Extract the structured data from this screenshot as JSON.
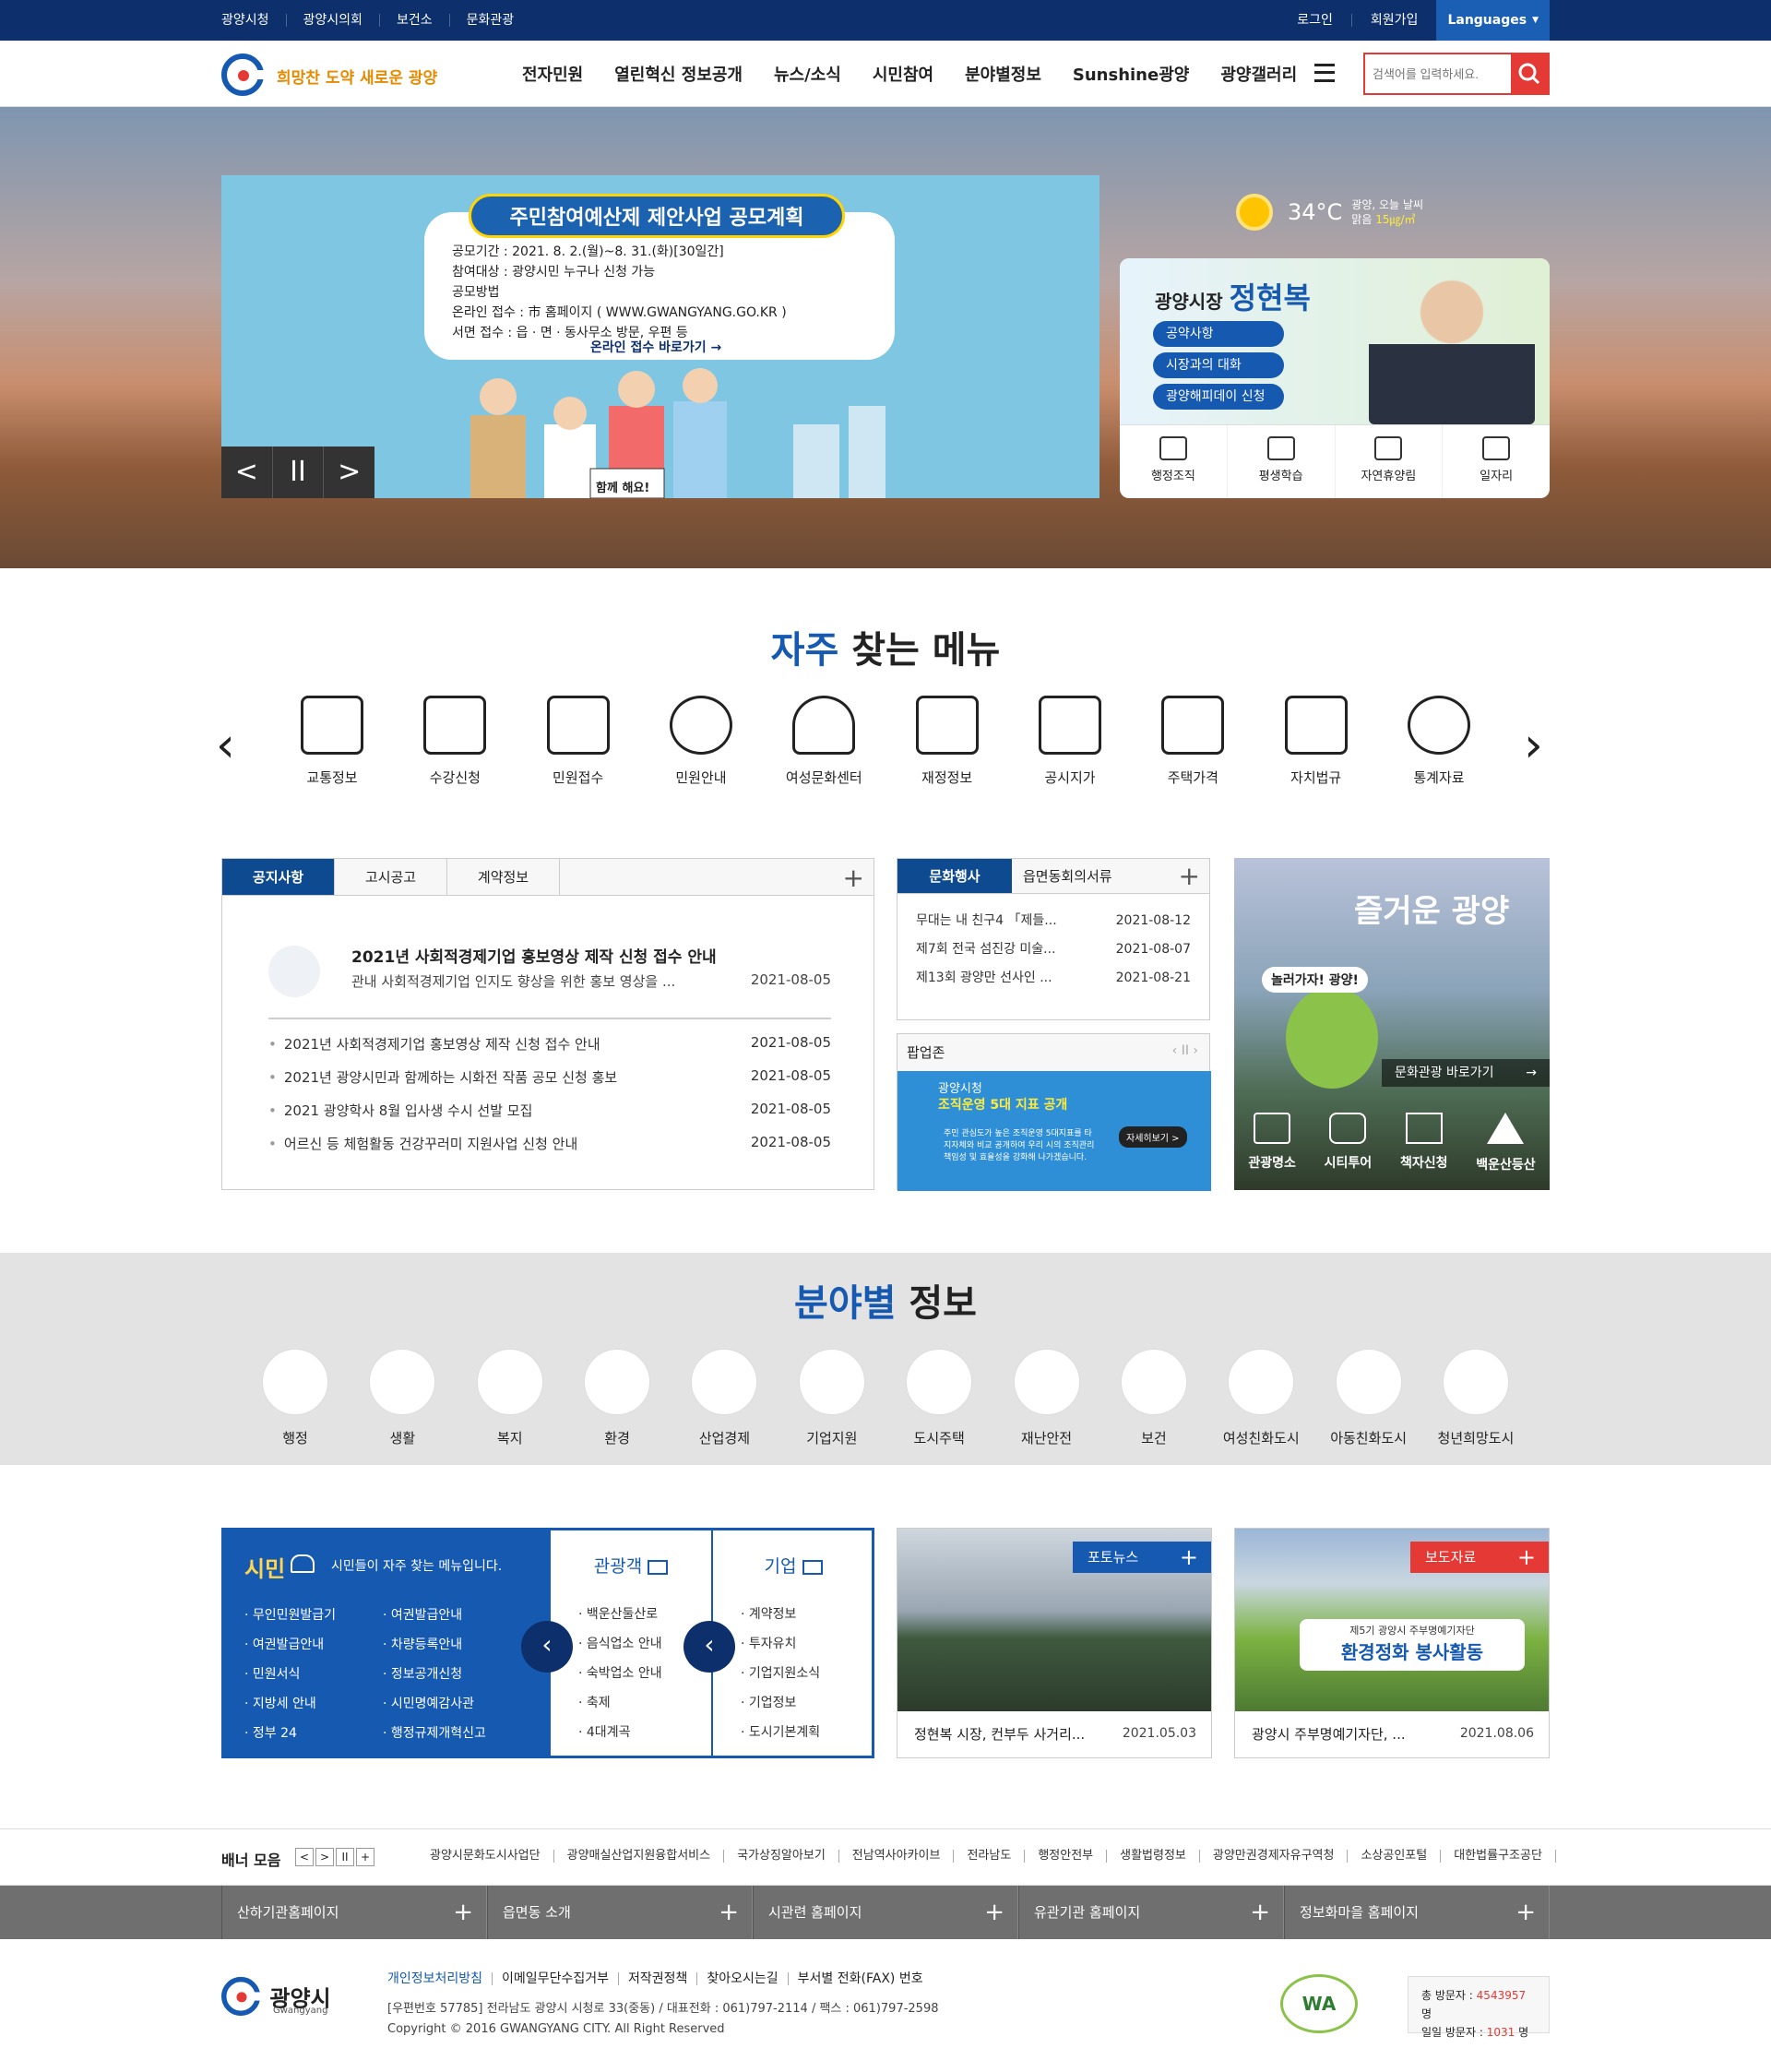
{
  "util": {
    "left": [
      "광양시청",
      "광양시의회",
      "보건소",
      "문화관광"
    ],
    "right": [
      "로그인",
      "회원가입"
    ],
    "language": "Languages"
  },
  "logo": {
    "slogan": "희망찬 도약 새로운 광양"
  },
  "gnb": [
    "전자민원",
    "열린혁신 정보공개",
    "뉴스/소식",
    "시민참여",
    "분야별정보",
    "Sunshine광양",
    "광양갤러리"
  ],
  "search": {
    "placeholder": "검색어를 입력하세요."
  },
  "hero_banner": {
    "title": "주민참여예산제 제안사업 공모계획",
    "lines": [
      "공모기간 : 2021. 8. 2.(월)~8. 31.(화)[30일간]",
      "참여대상 : 광양시민 누구나 신청 가능",
      "공모방법",
      "온라인 접수 : 市 홈페이지 ( WWW.GWANGYANG.GO.KR )",
      "서면 접수 : 읍 · 면 · 동사무소 방문, 우편 등"
    ],
    "link": "온라인 접수 바로가기 →",
    "sign": "함께 해요!",
    "controls": [
      "<",
      "II",
      ">"
    ]
  },
  "weather": {
    "temp": "34°C",
    "line1": "광양, 오늘 날씨",
    "line2": "맑음",
    "dust": "15㎍/㎥"
  },
  "mayor": {
    "prefix": "광양시장",
    "name": "정현복",
    "buttons": [
      "공약사항",
      "시장과의 대화",
      "광양해피데이 신청"
    ],
    "icons": [
      "행정조직",
      "평생학습",
      "자연휴양림",
      "일자리"
    ]
  },
  "quick": {
    "title_accent": "자주",
    "title_rest": " 찾는 메뉴",
    "items": [
      "교통정보",
      "수강신청",
      "민원접수",
      "민원안내",
      "여성문화센터",
      "재정정보",
      "공시지가",
      "주택가격",
      "자치법규",
      "통계자료"
    ]
  },
  "notice": {
    "tabs": [
      "공지사항",
      "고시공고",
      "계약정보"
    ],
    "featured": {
      "title": "2021년 사회적경제기업 홍보영상 제작 신청 접수 안내",
      "summary": "관내 사회적경제기업 인지도 향상을 위한 홍보 영상을 ...",
      "date": "2021-08-05"
    },
    "items": [
      {
        "title": "2021년 사회적경제기업 홍보영상 제작 신청 접수 안내",
        "date": "2021-08-05"
      },
      {
        "title": "2021년 광양시민과 함께하는 시화전 작품 공모 신청 홍보",
        "date": "2021-08-05"
      },
      {
        "title": "2021 광양학사 8월 입사생 수시 선발 모집",
        "date": "2021-08-05"
      },
      {
        "title": "어르신 등 체험활동 건강꾸러미 지원사업 신청 안내",
        "date": "2021-08-05"
      }
    ]
  },
  "culture": {
    "tabs": [
      "문화행사",
      "읍면동회의서류"
    ],
    "items": [
      {
        "title": "무대는 내 친구4 「제들...",
        "date": "2021-08-12"
      },
      {
        "title": "제7회 전국 섬진강 미술...",
        "date": "2021-08-07"
      },
      {
        "title": "제13회 광양만 선사인 ...",
        "date": "2021-08-21"
      }
    ]
  },
  "popup": {
    "label": "팝업존",
    "line1": "광양시청",
    "line2": "조직운영 5대 지표 공개",
    "desc": "주민 관심도가 높은 조직운영 5대지표를 타 지자체와 비교 공개하여 우리 시의 조직관리 책임성 및 효율성을 강화해 나가겠습니다.",
    "more": "자세히보기 >"
  },
  "tour": {
    "title": "즐거운 광양",
    "sign": "놀러가자! 광양!",
    "link": "문화관광 바로가기",
    "items": [
      "관광명소",
      "시티투어",
      "책자신청",
      "백운산등산"
    ]
  },
  "field": {
    "title_accent": "분야별",
    "title_rest": " 정보",
    "items": [
      "행정",
      "생활",
      "복지",
      "환경",
      "산업경제",
      "기업지원",
      "도시주택",
      "재난안전",
      "보건",
      "여성친화도시",
      "아동친화도시",
      "청년희망도시"
    ]
  },
  "citizen": {
    "title": "시민",
    "desc": "시민들이 자주 찾는 메뉴입니다.",
    "col1": [
      "· 무인민원발급기",
      "· 여권발급안내",
      "· 민원서식",
      "· 지방세 안내",
      "· 정부 24"
    ],
    "col2": [
      "· 여권발급안내",
      "· 차량등록안내",
      "· 정보공개신청",
      "· 시민명예감사관",
      "· 행정규제개혁신고"
    ],
    "tourist_title": "관광객",
    "tourist": [
      "· 백운산둘산로",
      "· 음식업소 안내",
      "· 숙박업소 안내",
      "· 축제",
      "· 4대계곡"
    ],
    "biz_title": "기업",
    "biz": [
      "· 계약정보",
      "· 투자유치",
      "· 기업지원소식",
      "· 기업정보",
      "· 도시기본계획"
    ]
  },
  "photo_news": {
    "tag": "포토뉴스",
    "caption": "정현복 시장, 컨부두 사거리...",
    "date": "2021.05.03"
  },
  "press": {
    "tag": "보도자료",
    "caption": "광양시 주부명예기자단, ...",
    "date": "2021.08.06",
    "banner1": "제5기 광양시 주부명예기자단",
    "banner2": "환경정화 봉사활동"
  },
  "banner_bar": {
    "label": "배너 모음",
    "controls": [
      "<",
      ">",
      "II",
      "+"
    ],
    "links": [
      "광양시문화도시사업단",
      "광양매실산업지원융합서비스",
      "국가상징알아보기",
      "전남역사아카이브",
      "전라남도",
      "행정안전부",
      "생활법령정보",
      "광양만권경제자유구역청",
      "소상공인포털",
      "대한법률구조공단"
    ]
  },
  "grey_bar": [
    "산하기관홈페이지",
    "읍면동 소개",
    "시관련 홈페이지",
    "유관기관 홈페이지",
    "정보화마을 홈페이지"
  ],
  "footer": {
    "logo": "광양시",
    "logo_en": "Gwangyang",
    "links": [
      "개인정보처리방침",
      "이메일무단수집거부",
      "저작권정책",
      "찾아오시는길",
      "부서별 전화(FAX) 번호"
    ],
    "address": "[우편번호 57785] 전라남도 광양시 시청로 33(중동) / 대표전화 : 061)797-2114 / 팩스 : 061)797-2598",
    "copyright": "Copyright © 2016 GWANGYANG CITY. All Right Reserved",
    "wa": "WA",
    "visitors_total_label": "총 방문자 :",
    "visitors_total": "4543957",
    "visitors_today_label": "일일 방문자 :",
    "visitors_today": "1031",
    "unit": "명"
  }
}
